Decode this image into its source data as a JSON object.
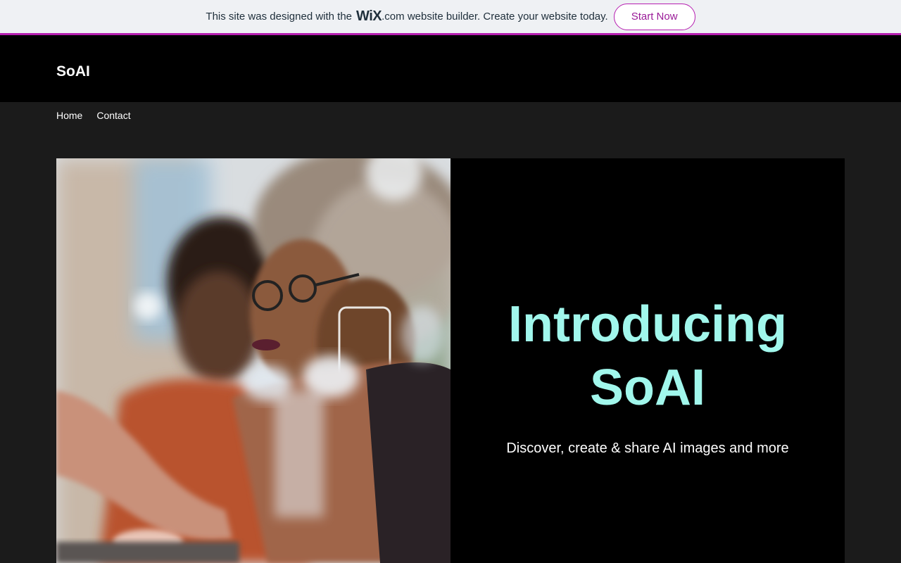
{
  "banner": {
    "text_before": "This site was designed with the",
    "logo": "WiX",
    "text_after": ".com website builder. Create your website today.",
    "button_label": "Start Now"
  },
  "header": {
    "site_name": "SoAI"
  },
  "nav": {
    "items": [
      {
        "label": "Home"
      },
      {
        "label": "Contact"
      }
    ]
  },
  "hero": {
    "title_line1": "Introducing",
    "title_line2": "SoAI",
    "subtitle": "Discover, create & share AI images and more",
    "image_description": "two-women-at-laptop-photo"
  },
  "colors": {
    "banner_accent": "#b61fb1",
    "hero_title": "#a1f7ec",
    "header_bg": "#000000",
    "page_bg": "#1b1b1b"
  }
}
